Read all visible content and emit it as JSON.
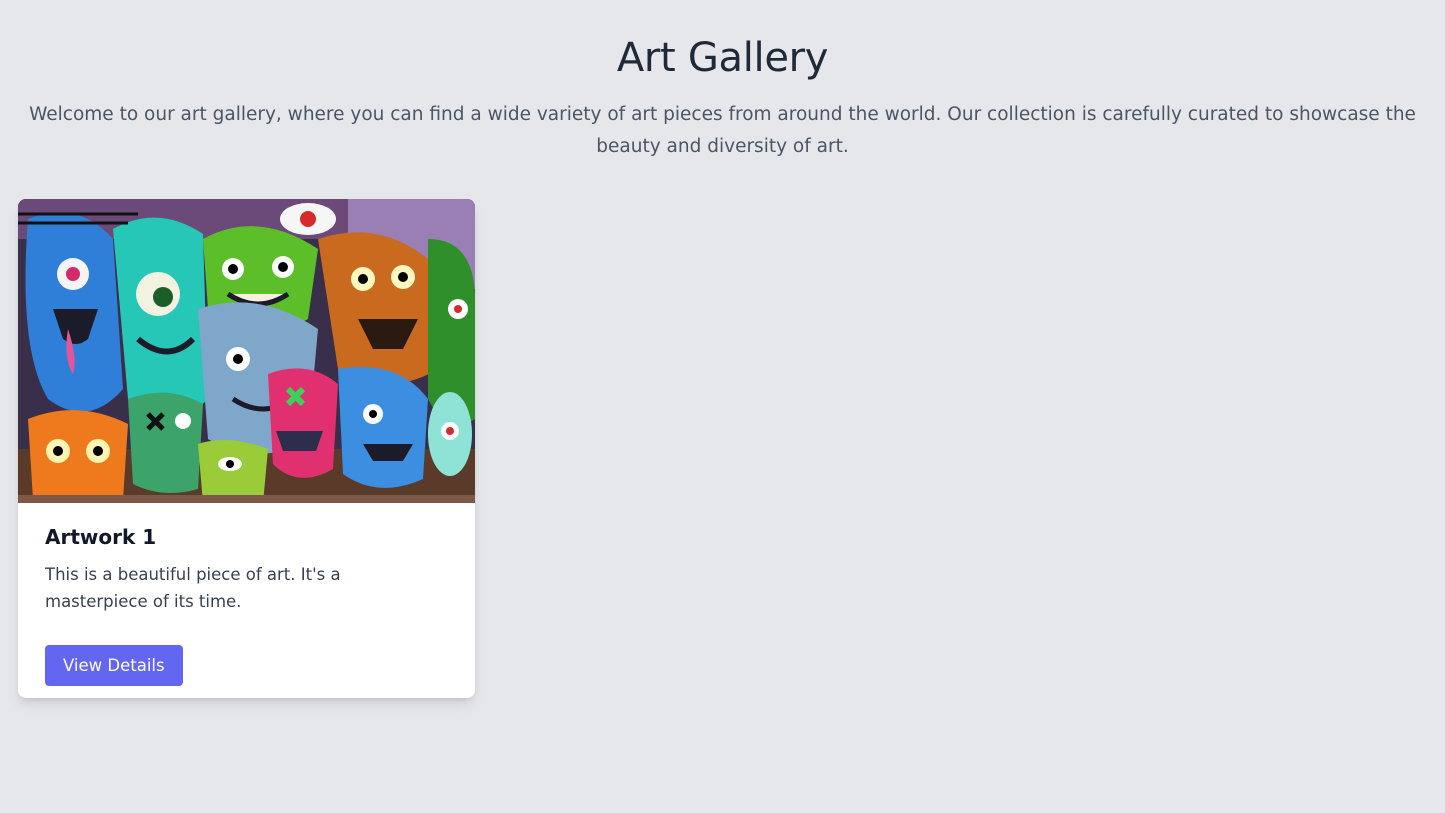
{
  "header": {
    "title": "Art Gallery",
    "subtitle": "Welcome to our art gallery, where you can find a wide variety of art pieces from around the world. Our collection is carefully curated to showcase the beauty and diversity of art."
  },
  "gallery": {
    "items": [
      {
        "title": "Artwork 1",
        "description": "This is a beautiful piece of art. It's a masterpiece of its time.",
        "button_label": "View Details",
        "image_alt": "colorful graffiti monsters"
      }
    ]
  },
  "colors": {
    "background": "#e5e7eb",
    "accent": "#6366f1",
    "card": "#ffffff",
    "title_text": "#1f2937",
    "body_text": "#4b5563"
  }
}
